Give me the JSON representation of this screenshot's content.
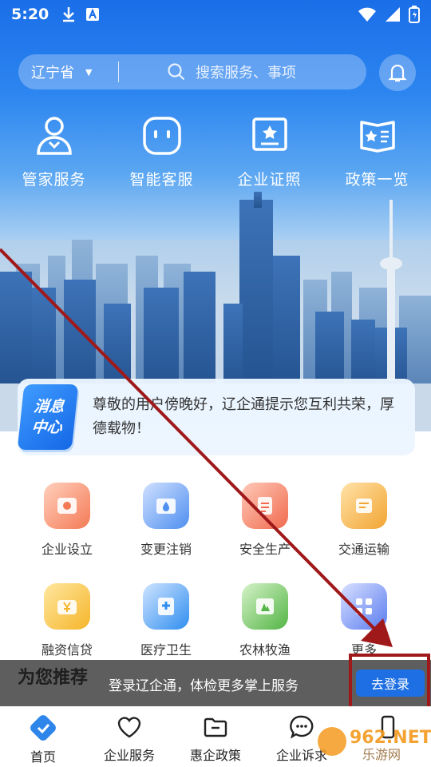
{
  "status_bar": {
    "time": "5:20"
  },
  "header": {
    "province": "辽宁省",
    "search_placeholder": "搜索服务、事项"
  },
  "quick_items": [
    {
      "label": "管家服务",
      "icon": "user-badge-icon"
    },
    {
      "label": "智能客服",
      "icon": "robot-face-icon"
    },
    {
      "label": "企业证照",
      "icon": "license-icon"
    },
    {
      "label": "政策一览",
      "icon": "policy-book-icon"
    }
  ],
  "message": {
    "badge_line1": "消息",
    "badge_line2": "中心",
    "text": "尊敬的用户傍晚好，辽企通提示您互利共荣，厚德载物！"
  },
  "services": [
    {
      "label": "企业设立",
      "color": "#f47a55"
    },
    {
      "label": "变更注销",
      "color": "#4f8ff0"
    },
    {
      "label": "安全生产",
      "color": "#f06a4e"
    },
    {
      "label": "交通运输",
      "color": "#f2a532"
    },
    {
      "label": "融资信贷",
      "color": "#f5b52a"
    },
    {
      "label": "医疗卫生",
      "color": "#2f8ef0"
    },
    {
      "label": "农林牧渔",
      "color": "#53b545"
    },
    {
      "label": "更多",
      "color": "#5a7cf0"
    }
  ],
  "recommend": {
    "title": "为您推荐",
    "text": "登录辽企通，体检更多掌上服务",
    "button": "去登录"
  },
  "bottom_nav": [
    {
      "label": "首页",
      "icon": "home-icon"
    },
    {
      "label": "企业服务",
      "icon": "heart-icon"
    },
    {
      "label": "惠企政策",
      "icon": "folder-icon"
    },
    {
      "label": "企业诉求",
      "icon": "chat-icon"
    },
    {
      "label": "",
      "icon": "phone-icon"
    }
  ],
  "watermark": {
    "brand": "962.NET",
    "sub": "乐游网"
  }
}
